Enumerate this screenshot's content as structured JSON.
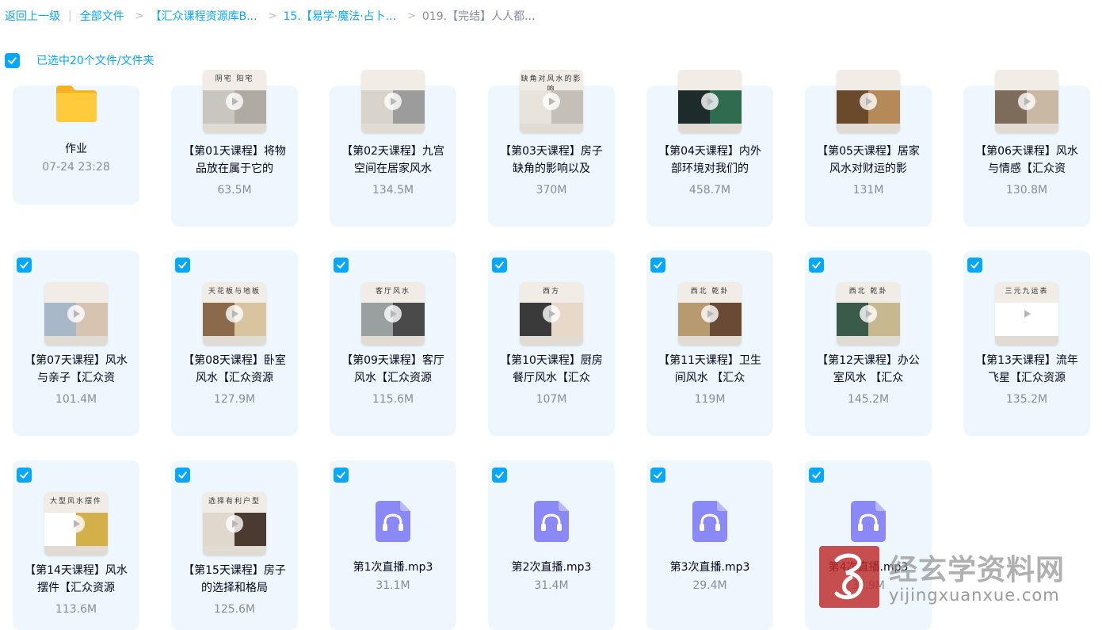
{
  "breadcrumb": {
    "back": "返回上一级",
    "items": [
      "全部文件",
      "【汇众课程资源库B...",
      "15.【易学·魔法·占卜...",
      "019.【完结】人人都..."
    ]
  },
  "selection": {
    "label": "已选中20个文件/文件夹"
  },
  "files": [
    {
      "name": "作业",
      "meta": "07-24 23:28",
      "type": "folder",
      "selected": false
    },
    {
      "name": "【第01天课程】将物品放在属于它的",
      "meta": "63.5M",
      "type": "video",
      "selected": false,
      "thumb_title": "阴宅    阳宅"
    },
    {
      "name": "【第02天课程】九宫空间在居家风水",
      "meta": "134.5M",
      "type": "video",
      "selected": false,
      "thumb_title": ""
    },
    {
      "name": "【第03天课程】房子缺角的影响以及",
      "meta": "370M",
      "type": "video",
      "selected": false,
      "thumb_title": "缺角对风水的影响"
    },
    {
      "name": "【第04天课程】内外部环境对我们的",
      "meta": "458.7M",
      "type": "video",
      "selected": false,
      "thumb_title": ""
    },
    {
      "name": "【第05天课程】居家风水对财运的影",
      "meta": "131M",
      "type": "video",
      "selected": false,
      "thumb_title": ""
    },
    {
      "name": "【第06天课程】风水与情感【汇众资",
      "meta": "130.8M",
      "type": "video",
      "selected": false,
      "thumb_title": ""
    },
    {
      "name": "【第07天课程】风水与亲子【汇众资",
      "meta": "101.4M",
      "type": "video",
      "selected": true,
      "thumb_title": ""
    },
    {
      "name": "【第08天课程】卧室风水【汇众资源",
      "meta": "127.9M",
      "type": "video",
      "selected": true,
      "thumb_title": "天花板与地板"
    },
    {
      "name": "【第09天课程】客厅风水【汇众资源",
      "meta": "115.6M",
      "type": "video",
      "selected": true,
      "thumb_title": "客厅风水"
    },
    {
      "name": "【第10天课程】厨房餐厅风水【汇众",
      "meta": "107M",
      "type": "video",
      "selected": true,
      "thumb_title": "西方"
    },
    {
      "name": "【第11天课程】卫生间风水 【汇众",
      "meta": "119M",
      "type": "video",
      "selected": true,
      "thumb_title": "西北 乾卦"
    },
    {
      "name": "【第12天课程】办公室风水 【汇众",
      "meta": "145.2M",
      "type": "video",
      "selected": true,
      "thumb_title": "西北 乾卦"
    },
    {
      "name": "【第13天课程】流年飞星【汇众资源",
      "meta": "135.2M",
      "type": "video",
      "selected": true,
      "thumb_title": "三元九运表"
    },
    {
      "name": "【第14天课程】风水摆件【汇众资源",
      "meta": "113.6M",
      "type": "video",
      "selected": true,
      "thumb_title": "大型风水摆件"
    },
    {
      "name": "【第15天课程】房子的选择和格局",
      "meta": "125.6M",
      "type": "video",
      "selected": true,
      "thumb_title": "选择有利户型"
    },
    {
      "name": "第1次直播.mp3",
      "meta": "31.1M",
      "type": "audio",
      "selected": true
    },
    {
      "name": "第2次直播.mp3",
      "meta": "31.4M",
      "type": "audio",
      "selected": true
    },
    {
      "name": "第3次直播.mp3",
      "meta": "29.4M",
      "type": "audio",
      "selected": true
    },
    {
      "name": "第4次直播.mp3",
      "meta": "3?.9M",
      "type": "audio",
      "selected": true
    }
  ],
  "watermark": {
    "brand": "经玄学资料网",
    "url": "yijingxuanxue.com"
  },
  "colors": {
    "accent": "#06a7ff",
    "card_bg": "#eef7fe",
    "folder": "#ffc93d",
    "audio": "#8b88f7"
  }
}
